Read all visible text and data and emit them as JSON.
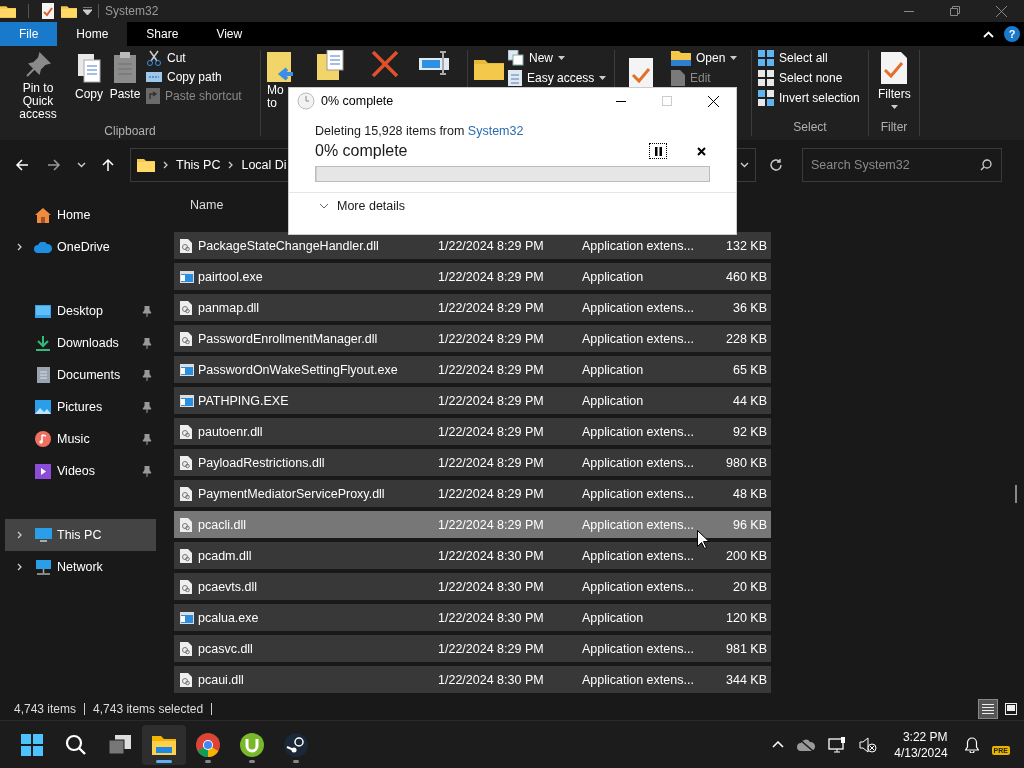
{
  "window": {
    "title": "System32"
  },
  "ribbon": {
    "tabs": [
      {
        "label": "File",
        "selected": false,
        "kind": "file"
      },
      {
        "label": "Home",
        "selected": true,
        "kind": "tab"
      },
      {
        "label": "Share",
        "selected": false,
        "kind": "tab"
      },
      {
        "label": "View",
        "selected": false,
        "kind": "tab"
      }
    ],
    "help_label": "?",
    "groups": [
      {
        "kind": "clipboard",
        "label": "Clipboard",
        "large": [
          {
            "label": "Pin to Quick access"
          },
          {
            "label": "Copy"
          },
          {
            "label": "Paste"
          }
        ],
        "small": [
          {
            "label": "Cut",
            "disabled": false,
            "dropdown": false
          },
          {
            "label": "Copy path",
            "disabled": false,
            "dropdown": false
          },
          {
            "label": "Paste shortcut",
            "disabled": true,
            "dropdown": false
          }
        ]
      },
      {
        "kind": "organize",
        "large": [
          {
            "label": "Mo\nto"
          }
        ]
      },
      {
        "kind": "new",
        "small": [
          {
            "label": "New",
            "disabled": false,
            "dropdown": true
          },
          {
            "label": "Easy access",
            "disabled": false,
            "dropdown": true
          }
        ]
      },
      {
        "kind": "open",
        "small": [
          {
            "label": "Open",
            "disabled": false,
            "dropdown": true
          },
          {
            "label": "Edit",
            "disabled": true,
            "dropdown": false
          }
        ]
      },
      {
        "kind": "select",
        "label": "Select",
        "small": [
          {
            "label": "Select all",
            "disabled": false,
            "dropdown": false
          },
          {
            "label": "Select none",
            "disabled": false,
            "dropdown": false
          },
          {
            "label": "Invert selection",
            "disabled": false,
            "dropdown": false
          }
        ]
      },
      {
        "kind": "filter",
        "label": "Filter",
        "large": [
          {
            "label": "Filters",
            "dropdown": true
          }
        ]
      }
    ]
  },
  "address": {
    "crumbs": [
      "This PC",
      "Local Di"
    ],
    "search_placeholder": "Search System32"
  },
  "sidebar": {
    "items": [
      {
        "label": "Home",
        "selected": false,
        "expandable": false,
        "pinned": false,
        "gap_before": false
      },
      {
        "label": "OneDrive",
        "selected": false,
        "expandable": true,
        "pinned": false,
        "gap_before": false
      },
      {
        "label": "Desktop",
        "selected": false,
        "expandable": false,
        "pinned": true,
        "gap_before": true
      },
      {
        "label": "Downloads",
        "selected": false,
        "expandable": false,
        "pinned": true,
        "gap_before": false
      },
      {
        "label": "Documents",
        "selected": false,
        "expandable": false,
        "pinned": true,
        "gap_before": false
      },
      {
        "label": "Pictures",
        "selected": false,
        "expandable": false,
        "pinned": true,
        "gap_before": false
      },
      {
        "label": "Music",
        "selected": false,
        "expandable": false,
        "pinned": true,
        "gap_before": false
      },
      {
        "label": "Videos",
        "selected": false,
        "expandable": false,
        "pinned": true,
        "gap_before": false
      },
      {
        "label": "This PC",
        "selected": true,
        "expandable": true,
        "pinned": false,
        "gap_before": true
      },
      {
        "label": "Network",
        "selected": false,
        "expandable": true,
        "pinned": false,
        "gap_before": false
      }
    ]
  },
  "table": {
    "columns": [
      "Name"
    ],
    "rows": [
      {
        "name": "PackageStateChangeHandler.dll",
        "date": "1/22/2024 8:29 PM",
        "type": "Application extens...",
        "size": "132 KB",
        "kind": "dll",
        "selected": true,
        "focused": false
      },
      {
        "name": "pairtool.exe",
        "date": "1/22/2024 8:29 PM",
        "type": "Application",
        "size": "460 KB",
        "kind": "exe",
        "selected": true,
        "focused": false
      },
      {
        "name": "panmap.dll",
        "date": "1/22/2024 8:29 PM",
        "type": "Application extens...",
        "size": "36 KB",
        "kind": "dll",
        "selected": true,
        "focused": false
      },
      {
        "name": "PasswordEnrollmentManager.dll",
        "date": "1/22/2024 8:29 PM",
        "type": "Application extens...",
        "size": "228 KB",
        "kind": "dll",
        "selected": true,
        "focused": false
      },
      {
        "name": "PasswordOnWakeSettingFlyout.exe",
        "date": "1/22/2024 8:29 PM",
        "type": "Application",
        "size": "65 KB",
        "kind": "exe",
        "selected": true,
        "focused": false
      },
      {
        "name": "PATHPING.EXE",
        "date": "1/22/2024 8:29 PM",
        "type": "Application",
        "size": "44 KB",
        "kind": "exe",
        "selected": true,
        "focused": false
      },
      {
        "name": "pautoenr.dll",
        "date": "1/22/2024 8:29 PM",
        "type": "Application extens...",
        "size": "92 KB",
        "kind": "dll",
        "selected": true,
        "focused": false
      },
      {
        "name": "PayloadRestrictions.dll",
        "date": "1/22/2024 8:29 PM",
        "type": "Application extens...",
        "size": "980 KB",
        "kind": "dll",
        "selected": true,
        "focused": false
      },
      {
        "name": "PaymentMediatorServiceProxy.dll",
        "date": "1/22/2024 8:29 PM",
        "type": "Application extens...",
        "size": "48 KB",
        "kind": "dll",
        "selected": true,
        "focused": false
      },
      {
        "name": "pcacli.dll",
        "date": "1/22/2024 8:29 PM",
        "type": "Application extens...",
        "size": "96 KB",
        "kind": "dll",
        "selected": true,
        "focused": true
      },
      {
        "name": "pcadm.dll",
        "date": "1/22/2024 8:30 PM",
        "type": "Application extens...",
        "size": "200 KB",
        "kind": "dll",
        "selected": true,
        "focused": false
      },
      {
        "name": "pcaevts.dll",
        "date": "1/22/2024 8:30 PM",
        "type": "Application extens...",
        "size": "20 KB",
        "kind": "dll",
        "selected": true,
        "focused": false
      },
      {
        "name": "pcalua.exe",
        "date": "1/22/2024 8:30 PM",
        "type": "Application",
        "size": "120 KB",
        "kind": "exe",
        "selected": true,
        "focused": false
      },
      {
        "name": "pcasvc.dll",
        "date": "1/22/2024 8:29 PM",
        "type": "Application extens...",
        "size": "981 KB",
        "kind": "dll",
        "selected": true,
        "focused": false
      },
      {
        "name": "pcaui.dll",
        "date": "1/22/2024 8:30 PM",
        "type": "Application extens...",
        "size": "344 KB",
        "kind": "dll",
        "selected": true,
        "focused": false
      }
    ]
  },
  "status_bar": {
    "items": [
      "4,743 items",
      "4,743 items selected"
    ],
    "views": [
      {
        "kind": "details",
        "selected": true
      },
      {
        "kind": "tiles",
        "selected": false
      }
    ]
  },
  "dialog": {
    "title": "0% complete",
    "message": "Deleting 15,928 items from",
    "source": "System32",
    "progress_text": "0% complete",
    "level": 0,
    "details_label": "More details"
  },
  "taskbar": {
    "apps": [
      {
        "kind": "explorer",
        "active": true,
        "running": true
      },
      {
        "kind": "chrome",
        "active": false,
        "running": true
      },
      {
        "kind": "torrent",
        "active": false,
        "running": true
      },
      {
        "kind": "steam",
        "active": false,
        "running": true
      }
    ],
    "time": "3:22 PM",
    "date": "4/13/2024",
    "badge": "PRE"
  }
}
